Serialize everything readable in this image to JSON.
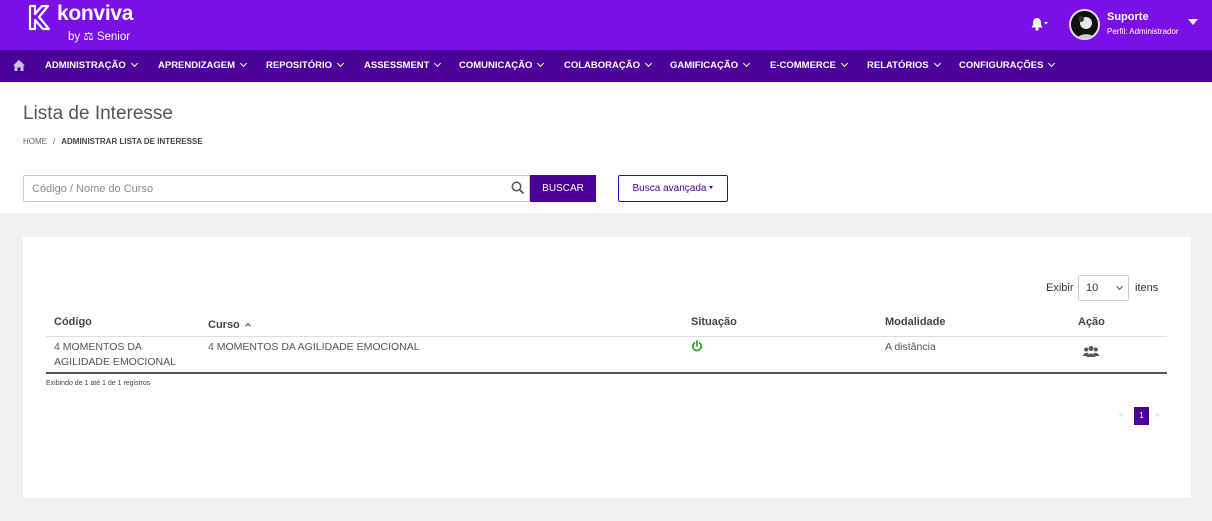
{
  "brand": {
    "name": "konviva",
    "by": "by ⚖ Senior"
  },
  "user": {
    "name": "Suporte",
    "profile": "Perfil: Administrador"
  },
  "nav": {
    "items": [
      {
        "label": "ADMINISTRAÇÃO"
      },
      {
        "label": "APRENDIZAGEM"
      },
      {
        "label": "REPOSITÓRIO"
      },
      {
        "label": "ASSESSMENT"
      },
      {
        "label": "COMUNICAÇÃO"
      },
      {
        "label": "COLABORAÇÃO"
      },
      {
        "label": "GAMIFICAÇÃO"
      },
      {
        "label": "E-COMMERCE"
      },
      {
        "label": "RELATÓRIOS"
      },
      {
        "label": "CONFIGURAÇÕES"
      }
    ]
  },
  "page": {
    "title": "Lista de Interesse",
    "breadcrumb": {
      "home": "HOME",
      "separator": "/",
      "current": "ADMINISTRAR LISTA DE INTERESSE"
    }
  },
  "search": {
    "placeholder": "Código / Nome do Curso",
    "button": "BUSCAR",
    "advanced": "Busca avançada"
  },
  "table": {
    "page_size": {
      "prefix": "Exibir",
      "value": "10",
      "suffix": "itens"
    },
    "columns": {
      "codigo": "Código",
      "curso": "Curso",
      "situacao": "Situação",
      "modalidade": "Modalidade",
      "acao": "Ação"
    },
    "rows": [
      {
        "codigo_line1": "4 MOMENTOS DA",
        "codigo_line2": "AGILIDADE EMOCIONAL",
        "curso": "4 MOMENTOS DA AGILIDADE EMOCIONAL",
        "situacao_icon": "power-icon",
        "modalidade": "A distância",
        "acao_icon": "users-icon"
      }
    ],
    "info": "Exibindo de 1 até 1 de 1 registros",
    "pagination": {
      "first": "«",
      "current": "1",
      "last": "»"
    }
  },
  "colors": {
    "header": "#7a0fe6",
    "nav": "#4b0197",
    "status_active": "#2e9e2e"
  }
}
